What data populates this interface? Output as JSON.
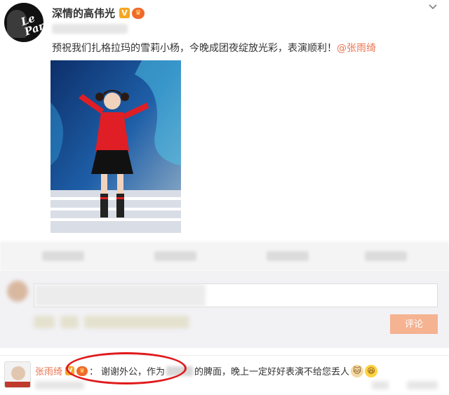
{
  "post": {
    "author_name": "深情的高伟光",
    "verified_badge": "V",
    "crown_badge": "♛",
    "avatar_logo": "Le Parc",
    "text": "预祝我们扎格拉玛的雪莉小杨，今晚成团夜绽放光彩，表演顺利！",
    "mention": "@张雨绮"
  },
  "composer": {
    "submit_label": "评论"
  },
  "comment": {
    "author_name": "张雨绮",
    "verified_badge": "V",
    "crown_badge": "♛",
    "colon": "：",
    "text_part1": "谢谢外公，作为",
    "text_part2": "的脾面，晚上一定好好表演不给您丢人",
    "emoji_1": "🐱",
    "emoji_2": "😆"
  },
  "colors": {
    "accent": "#eb7350",
    "highlight_circle": "#e0191b",
    "submit_button": "#f5b392",
    "v_badge": "#f5a623"
  },
  "icons": [
    "chevron-down-icon",
    "verified-v-icon",
    "crown-member-icon",
    "cat-emoji-icon",
    "laughing-emoji-icon"
  ]
}
